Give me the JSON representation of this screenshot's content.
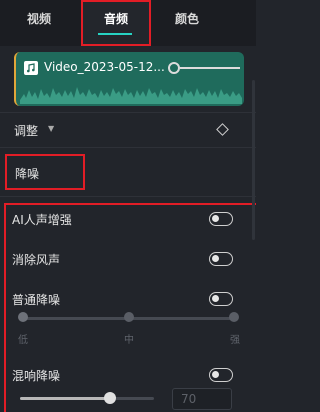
{
  "tabs": [
    {
      "label": "视频"
    },
    {
      "label": "音频"
    },
    {
      "label": "颜色"
    }
  ],
  "active_tab": "音频",
  "clip": {
    "name": "Video_2023-05-12...",
    "icon": "music-note-icon",
    "color": "#1f6b5c"
  },
  "adjust": {
    "label": "调整"
  },
  "noise_section": {
    "label": "降噪"
  },
  "options": [
    {
      "label": "AI人声增强"
    },
    {
      "label": "消除风声"
    },
    {
      "label": "普通降噪"
    },
    {
      "label": "混响降噪"
    }
  ],
  "noise_level": {
    "ticks": [
      "低",
      "中",
      "强"
    ],
    "selected": "低"
  },
  "reverb": {
    "value": "70",
    "level": 0.65
  },
  "colors": {
    "accent": "#27d3c3",
    "highlight": "#e21d26",
    "background": "#22252b"
  }
}
